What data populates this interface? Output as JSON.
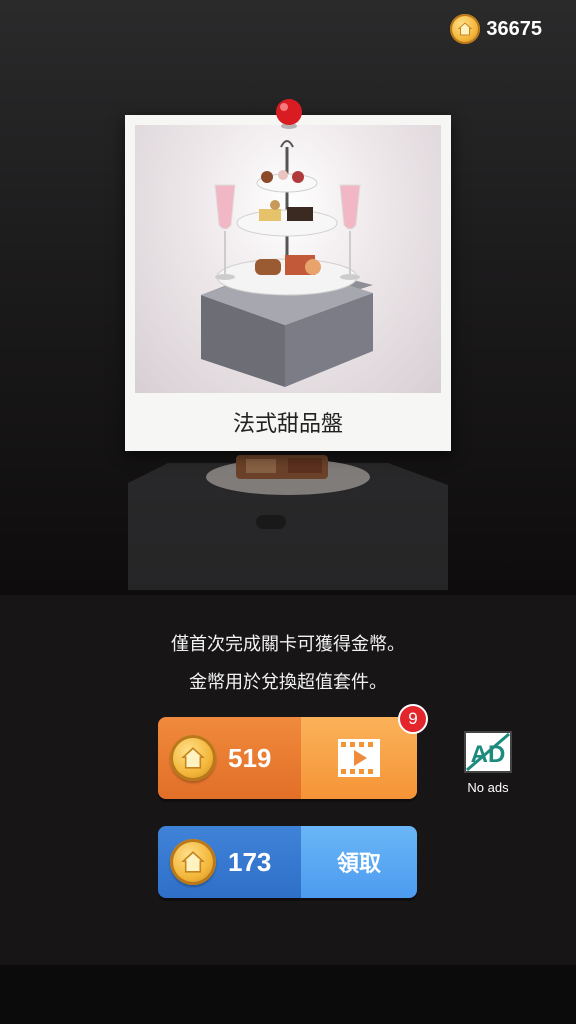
{
  "header": {
    "coin_total": "36675",
    "coin_icon": "home-coin-icon"
  },
  "card": {
    "caption": "法式甜品盤",
    "pin_icon": "pushpin-icon"
  },
  "info": {
    "line1": "僅首次完成關卡可獲得金幣。",
    "line2": "金幣用於兌換超值套件。"
  },
  "video_reward": {
    "amount": "519",
    "icon": "play-video-icon",
    "badge_count": "9"
  },
  "claim_reward": {
    "amount": "173",
    "label": "領取"
  },
  "no_ads": {
    "icon_text": "AD",
    "label": "No ads"
  },
  "colors": {
    "orange_left": "#e26f28",
    "orange_right": "#f59436",
    "blue_left": "#2f6fc8",
    "blue_right": "#4c9bef",
    "badge_red": "#e3262c",
    "coin_gold": "#f3b63a"
  }
}
